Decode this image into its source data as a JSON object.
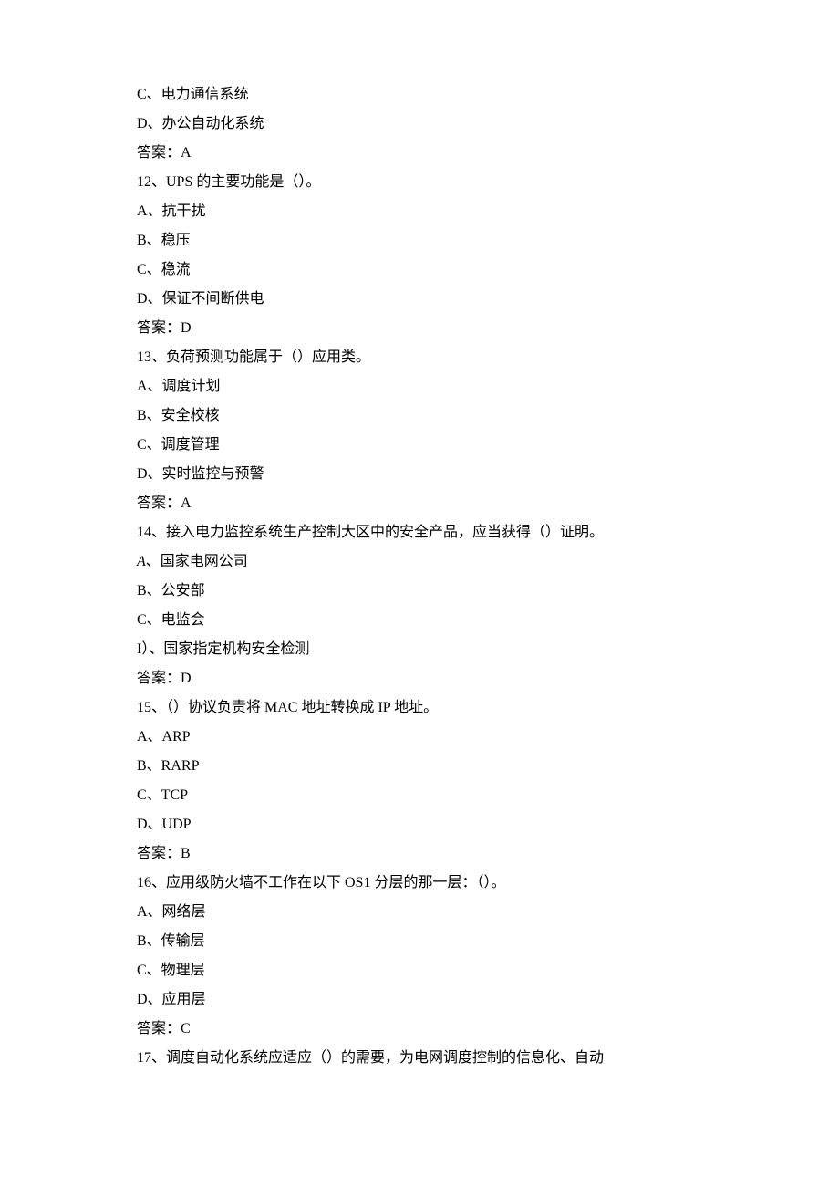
{
  "lines": {
    "q11_c": "C、电力通信系统",
    "q11_d": "D、办公自动化系统",
    "q11_ans": "答案：A",
    "q12": "12、UPS 的主要功能是（）。",
    "q12_a": "A、抗干扰",
    "q12_b": "B、稳压",
    "q12_c": "C、稳流",
    "q12_d": "D、保证不间断供电",
    "q12_ans": "答案：D",
    "q13": "13、负荷预测功能属于（）应用类。",
    "q13_a": "A、调度计划",
    "q13_b": "B、安全校核",
    "q13_c": "C、调度管理",
    "q13_d": "D、实时监控与预警",
    "q13_ans": "答案：A",
    "q14": "14、接入电力监控系统生产控制大区中的安全产品，应当获得（）证明。",
    "q14_a_label": "A",
    "q14_a_text": "、国家电网公司",
    "q14_b": "B、公安部",
    "q14_c": "C、电监会",
    "q14_d": "I）、国家指定机构安全检测",
    "q14_ans": "答案：D",
    "q15": "15、（）协议负责将 MAC 地址转换成 IP 地址。",
    "q15_a": "A、ARP",
    "q15_b": "B、RARP",
    "q15_c": "C、TCP",
    "q15_d": "D、UDP",
    "q15_ans": "答案：B",
    "q16": "16、应用级防火墙不工作在以下 OS1 分层的那一层：（）。",
    "q16_a": "A、网络层",
    "q16_b": "B、传输层",
    "q16_c": "C、物理层",
    "q16_d": "D、应用层",
    "q16_ans": "答案：C",
    "q17": "17、调度自动化系统应适应（）的需要，为电网调度控制的信息化、自动"
  }
}
